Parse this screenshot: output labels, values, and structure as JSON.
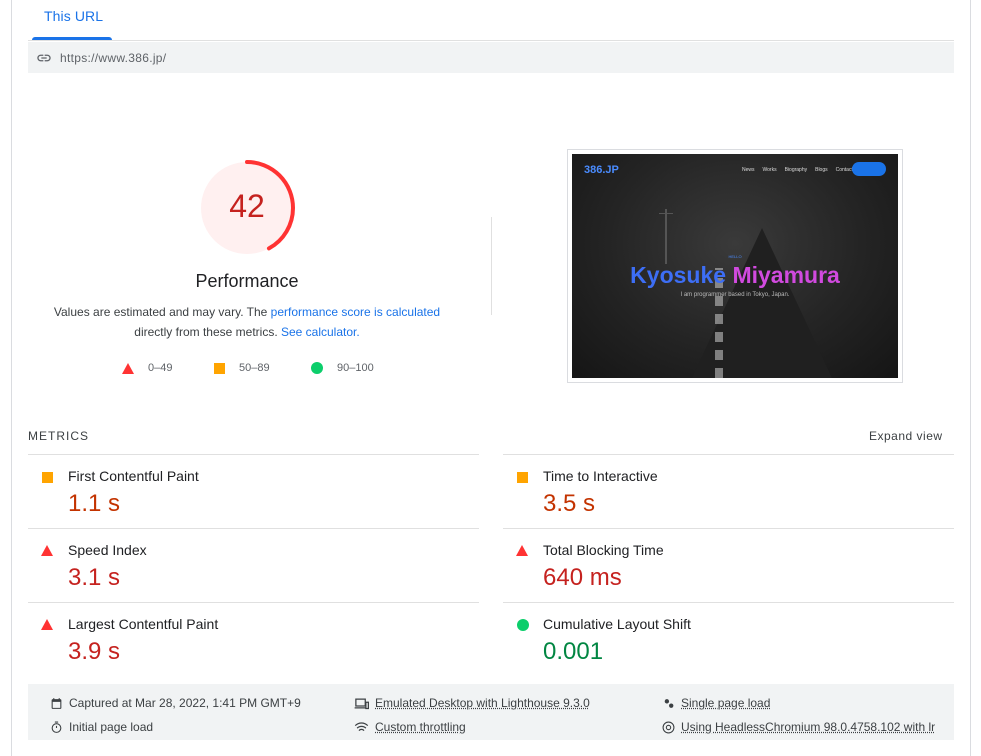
{
  "tab": {
    "label": "This URL"
  },
  "url": "https://www.386.jp/",
  "performance": {
    "score": "42",
    "label": "Performance",
    "desc_prefix": "Values are estimated and may vary. The ",
    "desc_link1": "performance score is calculated",
    "desc_middle": "directly from these metrics. ",
    "desc_link2": "See calculator.",
    "score_fraction": 0.42,
    "color": "#ff3333"
  },
  "legend": [
    {
      "range": "0–49",
      "shape": "triangle",
      "color": "#ff3333"
    },
    {
      "range": "50–89",
      "shape": "square",
      "color": "#ffa400"
    },
    {
      "range": "90–100",
      "shape": "circle",
      "color": "#0cce6b"
    }
  ],
  "screenshot": {
    "logo": "386.JP",
    "nav": [
      "News",
      "Works",
      "Biography",
      "Blogs",
      "Contact"
    ],
    "hello": "HELLO",
    "hero_first": "Kyosuke",
    "hero_last": "Miyamura",
    "subtitle": "I am programmer based in Tokyo, Japan."
  },
  "metrics_section": {
    "title": "METRICS",
    "expand_label": "Expand view"
  },
  "metrics": [
    {
      "label": "First Contentful Paint",
      "value": "1.1 s",
      "rating": "average"
    },
    {
      "label": "Time to Interactive",
      "value": "3.5 s",
      "rating": "average"
    },
    {
      "label": "Speed Index",
      "value": "3.1 s",
      "rating": "fail"
    },
    {
      "label": "Total Blocking Time",
      "value": "640 ms",
      "rating": "fail"
    },
    {
      "label": "Largest Contentful Paint",
      "value": "3.9 s",
      "rating": "fail"
    },
    {
      "label": "Cumulative Layout Shift",
      "value": "0.001",
      "rating": "pass"
    }
  ],
  "footer": {
    "captured": "Captured at Mar 28, 2022, 1:41 PM GMT+9",
    "initial_load": "Initial page load",
    "emulated": "Emulated Desktop with Lighthouse 9.3.0",
    "throttling": "Custom throttling",
    "single_load": "Single page load",
    "browser": "Using HeadlessChromium 98.0.4758.102 with lr"
  }
}
